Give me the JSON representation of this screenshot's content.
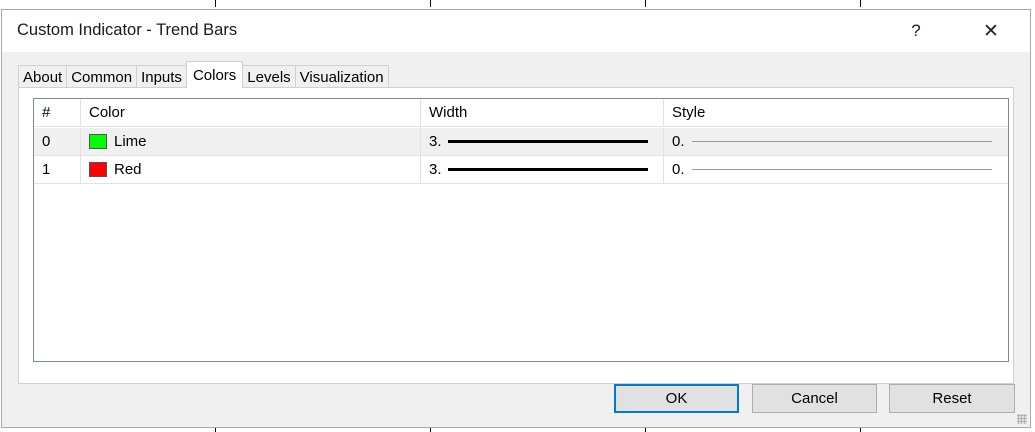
{
  "window": {
    "title": "Custom Indicator - Trend Bars",
    "help_label": "?",
    "close_label": "✕"
  },
  "tabs": [
    {
      "label": "About"
    },
    {
      "label": "Common"
    },
    {
      "label": "Inputs"
    },
    {
      "label": "Colors",
      "active": true
    },
    {
      "label": "Levels"
    },
    {
      "label": "Visualization"
    }
  ],
  "table": {
    "headers": [
      "#",
      "Color",
      "Width",
      "Style"
    ],
    "rows": [
      {
        "index": "0",
        "color_name": "Lime",
        "color_hex": "#00ff00",
        "width": "3.",
        "style": "0."
      },
      {
        "index": "1",
        "color_name": "Red",
        "color_hex": "#ff0000",
        "width": "3.",
        "style": "0."
      }
    ]
  },
  "buttons": {
    "ok": "OK",
    "cancel": "Cancel",
    "reset": "Reset"
  }
}
